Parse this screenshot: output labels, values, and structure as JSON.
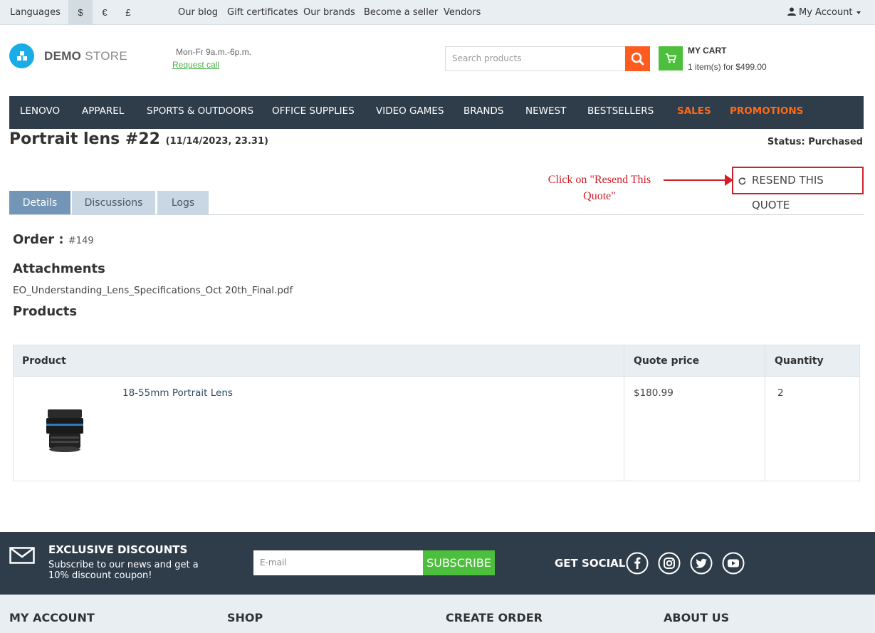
{
  "topbar": {
    "languages": "Languages",
    "currencies": [
      "$",
      "€",
      "£"
    ],
    "links": [
      "Our blog",
      "Gift certificates",
      "Our brands",
      "Become a seller",
      "Vendors"
    ],
    "account": "My Account"
  },
  "header": {
    "logo_demo": "DEMO",
    "logo_store": " STORE",
    "hours": "Mon-Fr 9a.m.-6p.m.",
    "request_call": "Request call",
    "search_placeholder": "Search products",
    "cart_title": "MY CART",
    "cart_summary": "1 item(s) for $499.00"
  },
  "nav": [
    "LENOVO",
    "APPAREL",
    "SPORTS & OUTDOORS",
    "OFFICE SUPPLIES",
    "VIDEO GAMES",
    "BRANDS",
    "NEWEST",
    "BESTSELLERS",
    "SALES",
    "PROMOTIONS"
  ],
  "quote": {
    "title": "Portrait lens #22",
    "date": "(11/14/2023, 23.31)",
    "status": "Status: Purchased",
    "resend_label": "RESEND THIS QUOTE",
    "annotation": "Click on \"Resend This Quote\""
  },
  "tabs": [
    "Details",
    "Discussions",
    "Logs"
  ],
  "details": {
    "order_label": "Order :",
    "order_number": "#149",
    "attachments_heading": "Attachments",
    "attachment_file": "EO_Understanding_Lens_Specifications_Oct 20th_Final.pdf",
    "products_heading": "Products"
  },
  "table": {
    "headers": [
      "Product",
      "Quote price",
      "Quantity"
    ],
    "rows": [
      {
        "name": "18-55mm Portrait Lens",
        "price": "$180.99",
        "qty": "2"
      }
    ]
  },
  "footer": {
    "exclusive_title": "EXCLUSIVE DISCOUNTS",
    "exclusive_sub": "Subscribe to our news and get a 10% discount coupon!",
    "email_placeholder": "E-mail",
    "subscribe": "SUBSCRIBE",
    "get_social": "GET SOCIAL",
    "columns": [
      "MY ACCOUNT",
      "SHOP",
      "CREATE ORDER",
      "ABOUT US"
    ]
  },
  "colors": {
    "nav_bg": "#2f3d4a",
    "accent_orange": "#ff6a17",
    "accent_green": "#4cbf3c",
    "annotation_red": "#d0202a",
    "tab_active": "#7395b6"
  }
}
